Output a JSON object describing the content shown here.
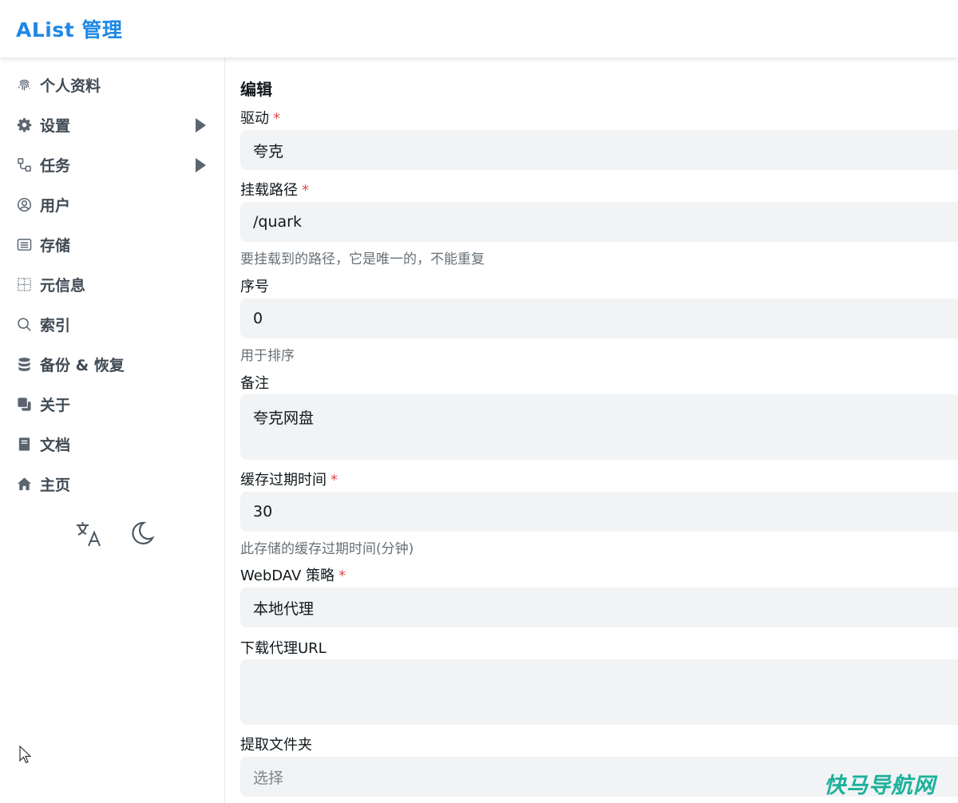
{
  "app": {
    "title": "AList 管理"
  },
  "sidebar": {
    "items": [
      {
        "label": "个人资料",
        "icon": "fingerprint-icon",
        "has_submenu": false
      },
      {
        "label": "设置",
        "icon": "gear-icon",
        "has_submenu": true
      },
      {
        "label": "任务",
        "icon": "workflow-icon",
        "has_submenu": true
      },
      {
        "label": "用户",
        "icon": "user-circle-icon",
        "has_submenu": false
      },
      {
        "label": "存储",
        "icon": "storage-list-icon",
        "has_submenu": false
      },
      {
        "label": "元信息",
        "icon": "meta-grid-icon",
        "has_submenu": false
      },
      {
        "label": "索引",
        "icon": "search-icon",
        "has_submenu": false
      },
      {
        "label": "备份 & 恢复",
        "icon": "database-icon",
        "has_submenu": false
      },
      {
        "label": "关于",
        "icon": "copy-icon",
        "has_submenu": false
      },
      {
        "label": "文档",
        "icon": "book-icon",
        "has_submenu": false
      },
      {
        "label": "主页",
        "icon": "home-icon",
        "has_submenu": false
      }
    ],
    "tools": {
      "language": "translate-icon",
      "theme": "moon-icon"
    }
  },
  "form": {
    "title": "编辑",
    "required_mark": "*",
    "driver": {
      "label": "驱动",
      "value": "夸克"
    },
    "mount_path": {
      "label": "挂载路径",
      "value": "/quark",
      "help": "要挂载到的路径，它是唯一的，不能重复"
    },
    "order": {
      "label": "序号",
      "value": "0",
      "help": "用于排序"
    },
    "remark": {
      "label": "备注",
      "value": "夸克网盘"
    },
    "cache_expiration": {
      "label": "缓存过期时间",
      "value": "30",
      "help": "此存储的缓存过期时间(分钟)"
    },
    "webdav_policy": {
      "label": "WebDAV 策略",
      "value": "本地代理"
    },
    "down_proxy_url": {
      "label": "下载代理URL",
      "value": ""
    },
    "extract_folder": {
      "label": "提取文件夹",
      "placeholder": "选择"
    }
  },
  "watermark": "快马导航网",
  "colors": {
    "brand": "#1e88e5",
    "required": "#e5484d",
    "input_bg": "#f1f3f5",
    "watermark": "#1db19a"
  }
}
